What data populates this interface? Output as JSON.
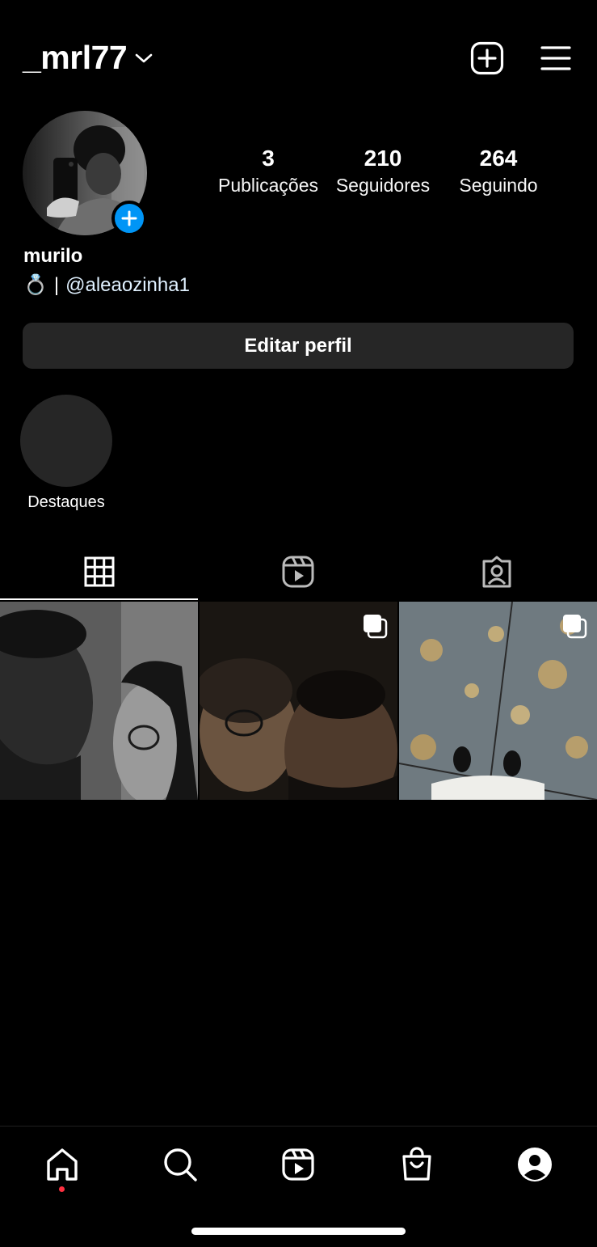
{
  "header": {
    "username": "_mrl77"
  },
  "profile": {
    "display_name": "murilo",
    "bio_emoji": "💍",
    "bio_separator": "|",
    "bio_mention": "@aleaozinha1",
    "stats": [
      {
        "count": "3",
        "label": "Publicações"
      },
      {
        "count": "210",
        "label": "Seguidores"
      },
      {
        "count": "264",
        "label": "Seguindo"
      }
    ],
    "edit_button": "Editar perfil"
  },
  "highlights": {
    "label": "Destaques"
  },
  "tabs": {
    "active": "grid",
    "items": [
      "grid-icon",
      "reels-icon",
      "tagged-icon"
    ]
  },
  "posts": [
    {
      "type": "single"
    },
    {
      "type": "carousel"
    },
    {
      "type": "carousel"
    }
  ],
  "bottom_nav": {
    "items": [
      "home-icon",
      "search-icon",
      "reels-icon",
      "shop-icon",
      "profile-icon"
    ],
    "active": "profile",
    "notification_dot_color": "#ff3040"
  },
  "colors": {
    "background": "#000000",
    "accent_blue": "#0095f6",
    "button_bg": "#262626"
  }
}
